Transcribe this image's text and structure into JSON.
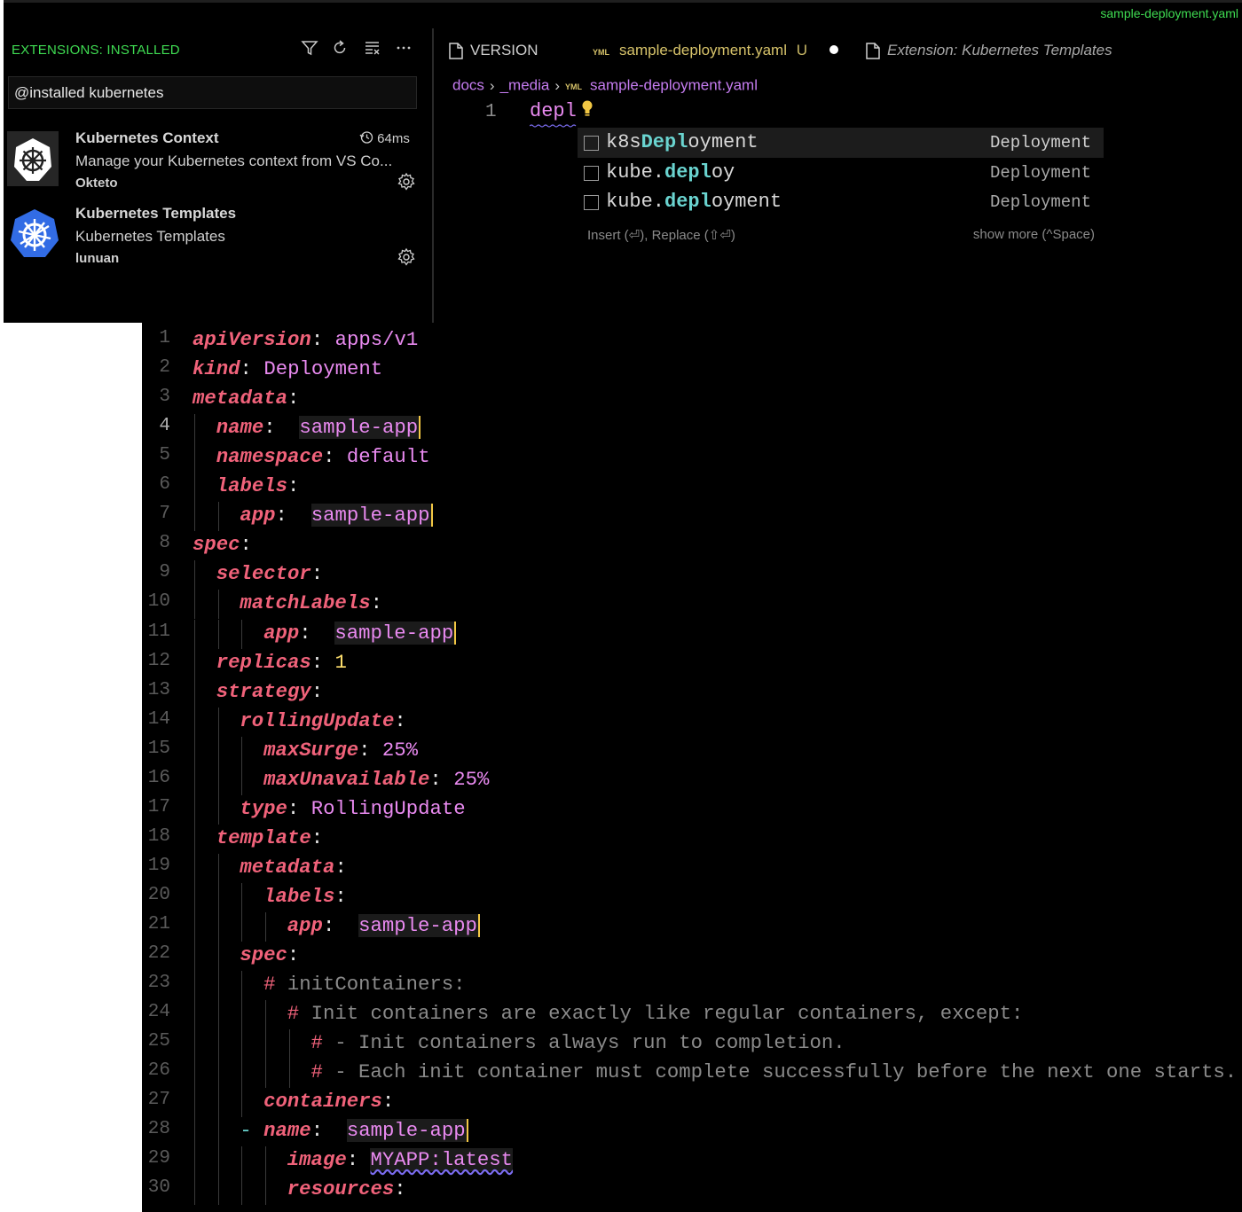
{
  "window": {
    "title": "sample-deployment.yaml"
  },
  "sidebar": {
    "header": "EXTENSIONS: INSTALLED",
    "toolbar_icons": [
      "filter-icon",
      "refresh-icon",
      "clear-icon",
      "more-icon"
    ],
    "search_value": "@installed kubernetes",
    "extensions": [
      {
        "name": "Kubernetes Context",
        "description": "Manage your Kubernetes context from VS Co...",
        "publisher": "Okteto",
        "time": "64ms",
        "icon": "helm-wheel-icon"
      },
      {
        "name": "Kubernetes Templates",
        "description": "Kubernetes Templates",
        "publisher": "lunuan",
        "icon": "kubernetes-icon"
      }
    ]
  },
  "tabs": [
    {
      "label": "VERSION",
      "icon": "file-icon"
    },
    {
      "label": "sample-deployment.yaml",
      "status": "U",
      "icon": "yaml-icon",
      "dirty": true
    },
    {
      "label": "Extension: Kubernetes Templates",
      "icon": "file-icon"
    }
  ],
  "breadcrumb": {
    "items": [
      "docs",
      "_media",
      "sample-deployment.yaml"
    ]
  },
  "editor_top": {
    "line_number": "1",
    "text": "depl"
  },
  "suggest": {
    "items": [
      {
        "prefix": "k8s",
        "match": "Depl",
        "suffix": "oyment",
        "detail": "Deployment"
      },
      {
        "prefix": "kube.",
        "match": "depl",
        "suffix": "oy",
        "detail": "Deployment"
      },
      {
        "prefix": "kube.",
        "match": "depl",
        "suffix": "oyment",
        "detail": "Deployment"
      }
    ],
    "footer_left": "Insert (⏎),   Replace (⇧⏎)",
    "footer_right": "show more (^Space)"
  },
  "colors": {
    "key": "#f0627a",
    "value": "#e98af0",
    "number": "#ffe06e",
    "accent_green": "#3fdc52",
    "cursor": "#f2c744"
  },
  "code": {
    "lines": [
      {
        "n": "1",
        "indent": 0,
        "key": "apiVersion",
        "value": "apps/v1"
      },
      {
        "n": "2",
        "indent": 0,
        "key": "kind",
        "value": "Deployment"
      },
      {
        "n": "3",
        "indent": 0,
        "key": "metadata",
        "value": ""
      },
      {
        "n": "4",
        "indent": 1,
        "key": "name",
        "value": "sample-app",
        "sel": true,
        "current": true
      },
      {
        "n": "5",
        "indent": 1,
        "key": "namespace",
        "value": "default"
      },
      {
        "n": "6",
        "indent": 1,
        "key": "labels",
        "value": ""
      },
      {
        "n": "7",
        "indent": 2,
        "key": "app",
        "value": "sample-app",
        "sel": true
      },
      {
        "n": "8",
        "indent": 0,
        "key": "spec",
        "value": ""
      },
      {
        "n": "9",
        "indent": 1,
        "key": "selector",
        "value": ""
      },
      {
        "n": "10",
        "indent": 2,
        "key": "matchLabels",
        "value": ""
      },
      {
        "n": "11",
        "indent": 3,
        "key": "app",
        "value": "sample-app",
        "sel": true
      },
      {
        "n": "12",
        "indent": 1,
        "key": "replicas",
        "value": "1",
        "number": true
      },
      {
        "n": "13",
        "indent": 1,
        "key": "strategy",
        "value": ""
      },
      {
        "n": "14",
        "indent": 2,
        "key": "rollingUpdate",
        "value": ""
      },
      {
        "n": "15",
        "indent": 3,
        "key": "maxSurge",
        "value": "25%"
      },
      {
        "n": "16",
        "indent": 3,
        "key": "maxUnavailable",
        "value": "25%"
      },
      {
        "n": "17",
        "indent": 2,
        "key": "type",
        "value": "RollingUpdate"
      },
      {
        "n": "18",
        "indent": 1,
        "key": "template",
        "value": ""
      },
      {
        "n": "19",
        "indent": 2,
        "key": "metadata",
        "value": ""
      },
      {
        "n": "20",
        "indent": 3,
        "key": "labels",
        "value": ""
      },
      {
        "n": "21",
        "indent": 4,
        "key": "app",
        "value": "sample-app",
        "sel": true
      },
      {
        "n": "22",
        "indent": 2,
        "key": "spec",
        "value": ""
      },
      {
        "n": "23",
        "indent": 3,
        "comment": "initContainers:"
      },
      {
        "n": "24",
        "indent": 4,
        "comment": "Init containers are exactly like regular containers, except:"
      },
      {
        "n": "25",
        "indent": 5,
        "comment": "- Init containers always run to completion."
      },
      {
        "n": "26",
        "indent": 5,
        "comment": "- Each init container must complete successfully before the next one starts."
      },
      {
        "n": "27",
        "indent": 3,
        "key": "containers",
        "value": ""
      },
      {
        "n": "28",
        "indent": 3,
        "dash": true,
        "key": "name",
        "value": "sample-app",
        "sel": true
      },
      {
        "n": "29",
        "indent": 4,
        "key": "image",
        "value": "MYAPP:latest",
        "squig": true
      },
      {
        "n": "30",
        "indent": 4,
        "key": "resources",
        "value": ""
      }
    ]
  }
}
